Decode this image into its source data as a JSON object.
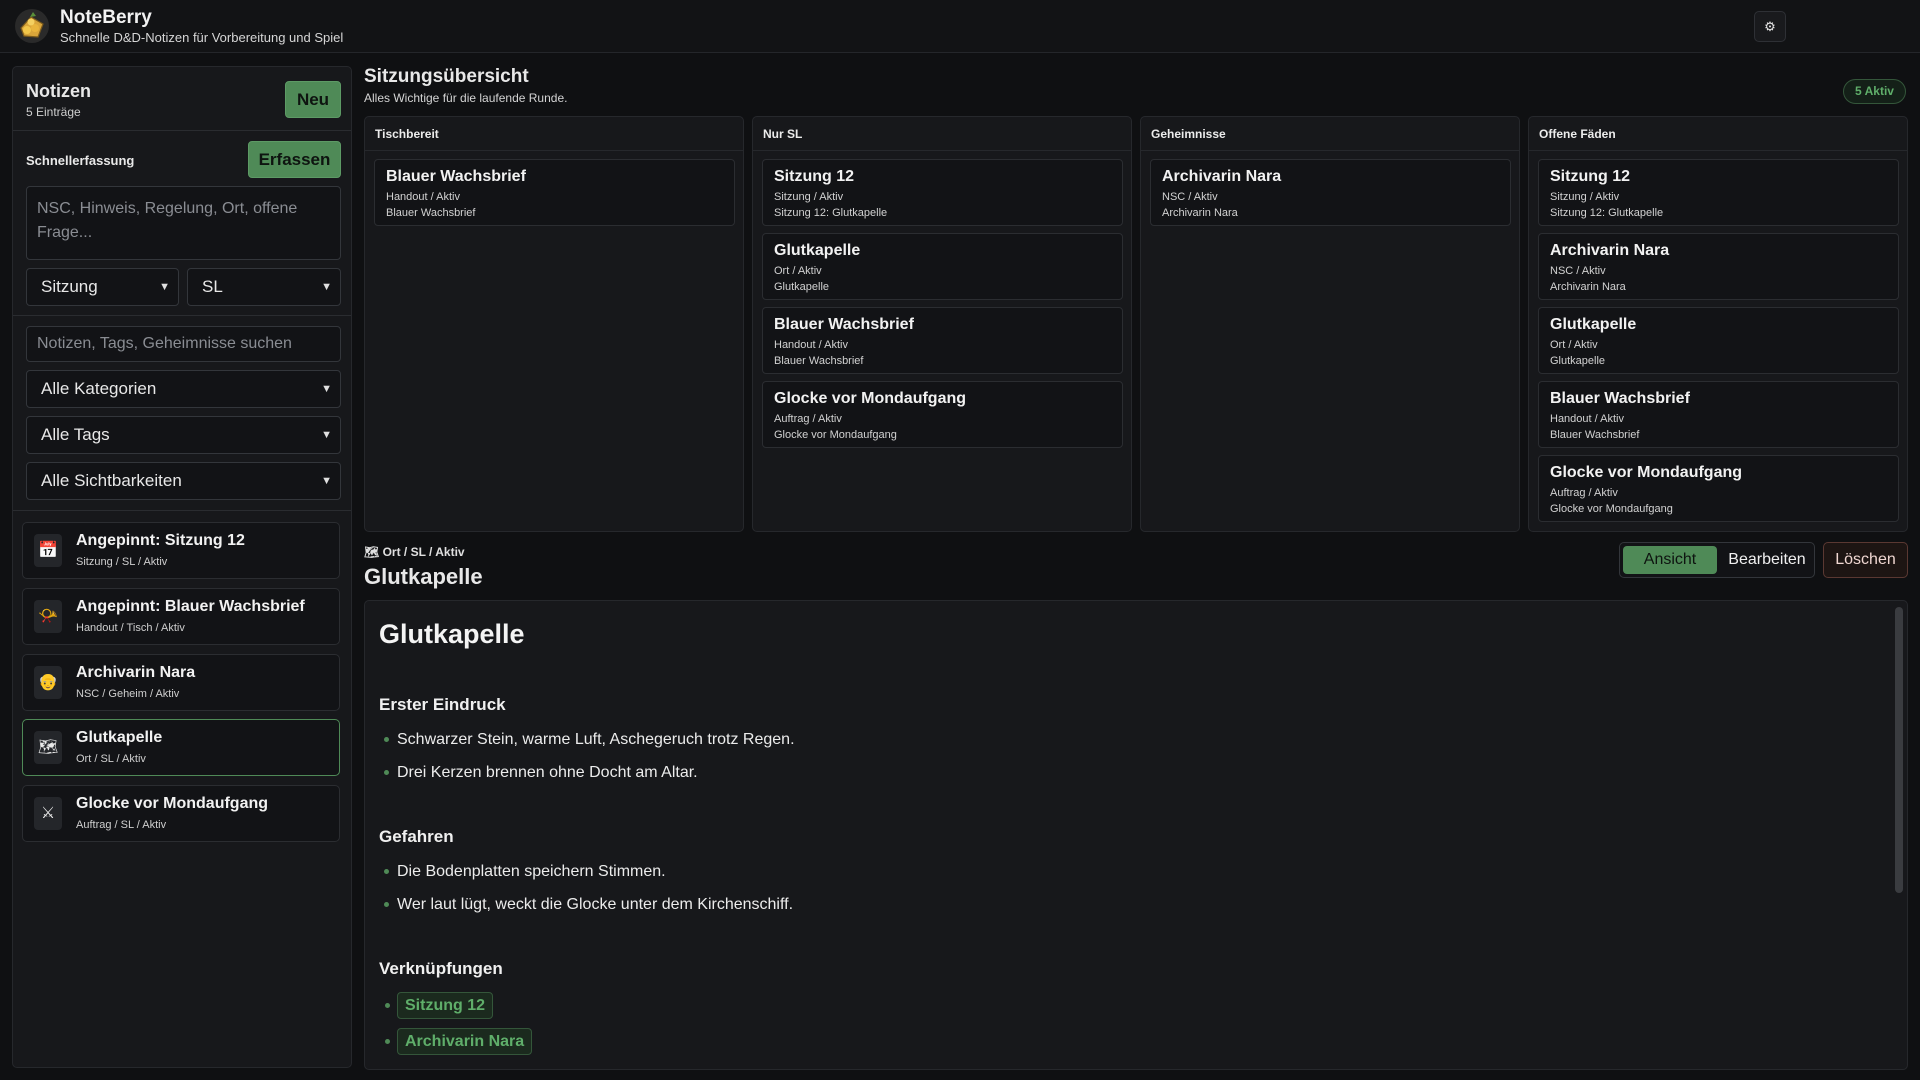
{
  "app": {
    "title": "NoteBerry",
    "subtitle": "Schnelle D&D-Notizen für Vorbereitung und Spiel",
    "settings_icon": "⚙"
  },
  "sidebar": {
    "title": "Notizen",
    "count": "5 Einträge",
    "new_label": "Neu",
    "quick_capture_label": "Schnellerfassung",
    "capture_label": "Erfassen",
    "textarea_placeholder": "NSC, Hinweis, Regelung, Ort, offene Frage...",
    "type_select": "Sitzung",
    "visibility_select": "SL",
    "search_placeholder": "Notizen, Tags, Geheimnisse suchen",
    "filter_categories": "Alle Kategorien",
    "filter_tags": "Alle Tags",
    "filter_visibility": "Alle Sichtbarkeiten",
    "notes": [
      {
        "icon": "📅",
        "icon_name": "calendar-icon",
        "title": "Angepinnt: Sitzung 12",
        "meta": "Sitzung / SL / Aktiv"
      },
      {
        "icon": "📯",
        "icon_name": "horn-icon",
        "title": "Angepinnt: Blauer Wachsbrief",
        "meta": "Handout / Tisch / Aktiv"
      },
      {
        "icon": "👴",
        "icon_name": "person-icon",
        "title": "Archivarin Nara",
        "meta": "NSC / Geheim / Aktiv"
      },
      {
        "icon": "🗺",
        "icon_name": "map-icon",
        "title": "Glutkapelle",
        "meta": "Ort / SL / Aktiv"
      },
      {
        "icon": "⚔",
        "icon_name": "swords-icon",
        "title": "Glocke vor Mondaufgang",
        "meta": "Auftrag / SL / Aktiv"
      }
    ]
  },
  "overview": {
    "title": "Sitzungsübersicht",
    "subtitle": "Alles Wichtige für die laufende Runde.",
    "active_badge": "5 Aktiv",
    "columns": [
      {
        "title": "Tischbereit",
        "cards": [
          {
            "title": "Blauer Wachsbrief",
            "l1": "Handout / Aktiv",
            "l2": "Blauer Wachsbrief"
          }
        ]
      },
      {
        "title": "Nur SL",
        "cards": [
          {
            "title": "Sitzung 12",
            "l1": "Sitzung / Aktiv",
            "l2": "Sitzung 12: Glutkapelle"
          },
          {
            "title": "Glutkapelle",
            "l1": "Ort / Aktiv",
            "l2": "Glutkapelle"
          },
          {
            "title": "Blauer Wachsbrief",
            "l1": "Handout / Aktiv",
            "l2": "Blauer Wachsbrief"
          },
          {
            "title": "Glocke vor Mondaufgang",
            "l1": "Auftrag / Aktiv",
            "l2": "Glocke vor Mondaufgang"
          }
        ]
      },
      {
        "title": "Geheimnisse",
        "cards": [
          {
            "title": "Archivarin Nara",
            "l1": "NSC / Aktiv",
            "l2": "Archivarin Nara"
          }
        ]
      },
      {
        "title": "Offene Fäden",
        "cards": [
          {
            "title": "Sitzung 12",
            "l1": "Sitzung / Aktiv",
            "l2": "Sitzung 12: Glutkapelle"
          },
          {
            "title": "Archivarin Nara",
            "l1": "NSC / Aktiv",
            "l2": "Archivarin Nara"
          },
          {
            "title": "Glutkapelle",
            "l1": "Ort / Aktiv",
            "l2": "Glutkapelle"
          },
          {
            "title": "Blauer Wachsbrief",
            "l1": "Handout / Aktiv",
            "l2": "Blauer Wachsbrief"
          },
          {
            "title": "Glocke vor Mondaufgang",
            "l1": "Auftrag / Aktiv",
            "l2": "Glocke vor Mondaufgang"
          }
        ]
      }
    ]
  },
  "detail": {
    "meta": "🗺 Ort / SL / Aktiv",
    "title": "Glutkapelle",
    "view_label": "Ansicht",
    "edit_label": "Bearbeiten",
    "delete_label": "Löschen",
    "doc": {
      "h1": "Glutkapelle",
      "section1": "Erster Eindruck",
      "s1_items": [
        "Schwarzer Stein, warme Luft, Aschegeruch trotz Regen.",
        "Drei Kerzen brennen ohne Docht am Altar."
      ],
      "section2": "Gefahren",
      "s2_items": [
        "Die Bodenplatten speichern Stimmen.",
        "Wer laut lügt, weckt die Glocke unter dem Kirchenschiff."
      ],
      "section3": "Verknüpfungen",
      "links": [
        "Sitzung 12",
        "Archivarin Nara"
      ]
    }
  },
  "colors": {
    "accent": "#4f8a57",
    "accent_text": "#5fae6a",
    "background": "#0f1012",
    "panel": "#17181b",
    "danger_border": "#5a3832"
  }
}
